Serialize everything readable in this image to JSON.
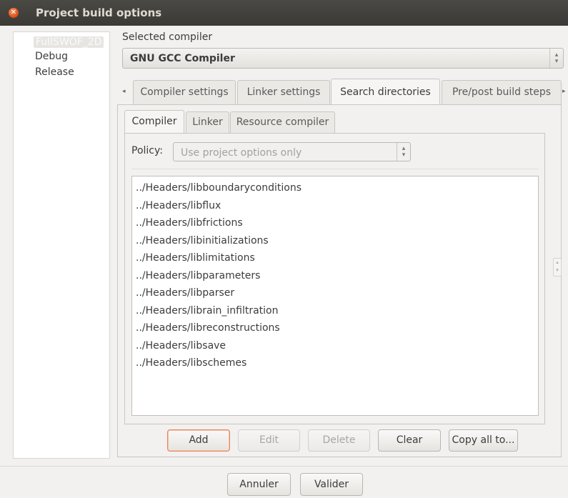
{
  "window": {
    "title": "Project build options"
  },
  "targets": [
    {
      "label": "FullSWOF_2D",
      "selected": true
    },
    {
      "label": "Debug",
      "selected": false
    },
    {
      "label": "Release",
      "selected": false
    }
  ],
  "compiler": {
    "label": "Selected compiler",
    "value": "GNU GCC Compiler"
  },
  "tabs": [
    {
      "label": "Compiler settings",
      "active": false
    },
    {
      "label": "Linker settings",
      "active": false
    },
    {
      "label": "Search directories",
      "active": true
    },
    {
      "label": "Pre/post build steps",
      "active": false
    }
  ],
  "subtabs": [
    {
      "label": "Compiler",
      "active": true
    },
    {
      "label": "Linker",
      "active": false
    },
    {
      "label": "Resource compiler",
      "active": false
    }
  ],
  "policy": {
    "label": "Policy:",
    "value": "Use project options only"
  },
  "directories": [
    "../Headers/libboundaryconditions",
    "../Headers/libflux",
    "../Headers/libfrictions",
    "../Headers/libinitializations",
    "../Headers/liblimitations",
    "../Headers/libparameters",
    "../Headers/libparser",
    "../Headers/librain_infiltration",
    "../Headers/libreconstructions",
    "../Headers/libsave",
    "../Headers/libschemes"
  ],
  "actions": {
    "add": "Add",
    "edit": "Edit",
    "delete": "Delete",
    "clear": "Clear",
    "copy_all": "Copy all to..."
  },
  "dialog": {
    "cancel": "Annuler",
    "ok": "Valider"
  },
  "colors": {
    "titlebar": "#3b3a36",
    "close": "#e2541d",
    "focus": "#e8855a"
  }
}
